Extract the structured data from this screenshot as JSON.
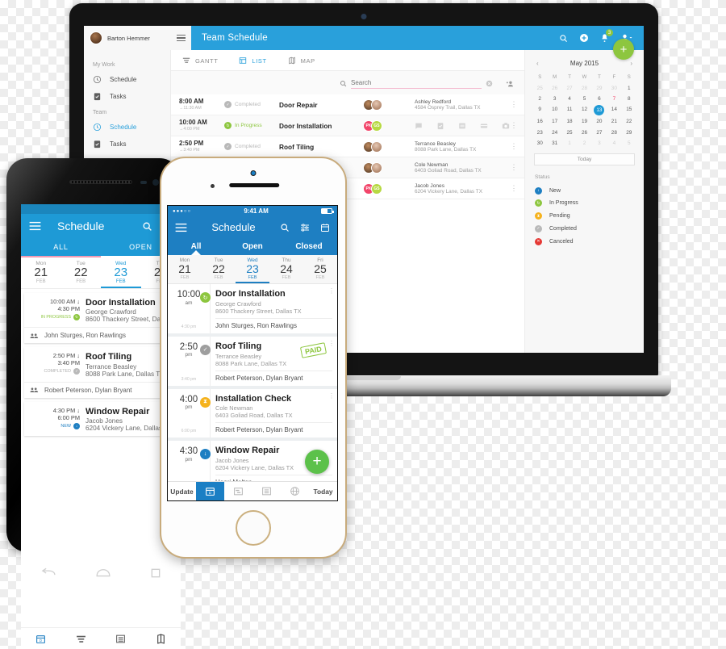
{
  "laptop": {
    "appbar": {
      "user_name": "Barton Hemmer",
      "title": "Team Schedule",
      "menu_icon": "hamburger-icon",
      "icons": [
        "search-icon",
        "add-circle-icon",
        "bell-icon",
        "account-icon"
      ],
      "notification_badge": "3"
    },
    "sidebar": {
      "sections": [
        {
          "label": "My Work",
          "items": [
            {
              "label": "Schedule",
              "icon": "clock-icon",
              "active": false
            },
            {
              "label": "Tasks",
              "icon": "clipboard-check-icon",
              "active": false
            }
          ]
        },
        {
          "label": "Team",
          "items": [
            {
              "label": "Schedule",
              "icon": "clock-icon",
              "active": true
            },
            {
              "label": "Tasks",
              "icon": "clipboard-check-icon",
              "active": false
            }
          ]
        }
      ]
    },
    "tabs": [
      {
        "label": "GANTT",
        "icon": "gantt-icon",
        "active": false
      },
      {
        "label": "LIST",
        "icon": "list-icon",
        "active": true
      },
      {
        "label": "MAP",
        "icon": "map-icon",
        "active": false
      }
    ],
    "search": {
      "placeholder": "Search",
      "value": "",
      "clear_icon": "clear-circle-icon",
      "add_user_icon": "add-person-icon"
    },
    "rows": [
      {
        "time": "8:00 AM",
        "end": "→11:30 AM",
        "status": "Completed",
        "status_color": "#b9b9b9",
        "title": "Door Repair",
        "avatars": [
          "photo1",
          "photo2"
        ],
        "person": "Ashley Redford",
        "address": "4584 Osprey Trail, Dallas TX",
        "mode": "person"
      },
      {
        "time": "10:00 AM",
        "end": "→4:00 PM",
        "status": "In Progress",
        "status_color": "#8dc63f",
        "title": "Door Installation",
        "avatars": [
          "PK",
          "GS"
        ],
        "person": "",
        "address": "",
        "mode": "icons",
        "action_icons": [
          "chat-icon",
          "checklist-icon",
          "document-icon",
          "card-icon",
          "camera-icon"
        ]
      },
      {
        "time": "2:50 PM",
        "end": "→3:40 PM",
        "status": "Completed",
        "status_color": "#b9b9b9",
        "title": "Roof Tiling",
        "avatars": [
          "photo1",
          "photo2"
        ],
        "person": "Terrance Beasley",
        "address": "8088 Park Lane, Dallas TX",
        "mode": "person"
      },
      {
        "time": "",
        "end": "",
        "status": "",
        "status_color": "",
        "title": "",
        "avatars": [
          "photo1",
          "photo2"
        ],
        "person": "Cole Newman",
        "address": "6403 Goliad Road, Dallas TX",
        "mode": "person"
      },
      {
        "time": "",
        "end": "",
        "status": "",
        "status_color": "",
        "title": "",
        "avatars": [
          "PK",
          "GS"
        ],
        "person": "Jacob Jones",
        "address": "6204 Vickery Lane, Dallas TX",
        "mode": "person"
      }
    ],
    "fab_label": "+",
    "calendar": {
      "month": "May 2015",
      "prev": "‹",
      "next": "›",
      "dow": [
        "S",
        "M",
        "T",
        "W",
        "T",
        "F",
        "S"
      ],
      "weeks": [
        [
          {
            "d": "25",
            "t": "mute"
          },
          {
            "d": "26",
            "t": "mute"
          },
          {
            "d": "27",
            "t": "mute"
          },
          {
            "d": "28",
            "t": "mute"
          },
          {
            "d": "29",
            "t": "mute"
          },
          {
            "d": "30",
            "t": "mute"
          },
          {
            "d": "1",
            "t": ""
          }
        ],
        [
          {
            "d": "2",
            "t": ""
          },
          {
            "d": "3",
            "t": ""
          },
          {
            "d": "4",
            "t": ""
          },
          {
            "d": "5",
            "t": ""
          },
          {
            "d": "6",
            "t": ""
          },
          {
            "d": "7",
            "t": "red"
          },
          {
            "d": "8",
            "t": ""
          }
        ],
        [
          {
            "d": "9",
            "t": ""
          },
          {
            "d": "10",
            "t": ""
          },
          {
            "d": "11",
            "t": ""
          },
          {
            "d": "12",
            "t": ""
          },
          {
            "d": "13",
            "t": "sel"
          },
          {
            "d": "14",
            "t": ""
          },
          {
            "d": "15",
            "t": ""
          }
        ],
        [
          {
            "d": "16",
            "t": ""
          },
          {
            "d": "17",
            "t": ""
          },
          {
            "d": "18",
            "t": ""
          },
          {
            "d": "19",
            "t": ""
          },
          {
            "d": "20",
            "t": ""
          },
          {
            "d": "21",
            "t": ""
          },
          {
            "d": "22",
            "t": ""
          }
        ],
        [
          {
            "d": "23",
            "t": ""
          },
          {
            "d": "24",
            "t": ""
          },
          {
            "d": "25",
            "t": ""
          },
          {
            "d": "26",
            "t": ""
          },
          {
            "d": "27",
            "t": ""
          },
          {
            "d": "28",
            "t": ""
          },
          {
            "d": "29",
            "t": ""
          }
        ],
        [
          {
            "d": "30",
            "t": ""
          },
          {
            "d": "31",
            "t": ""
          },
          {
            "d": "1",
            "t": "mute"
          },
          {
            "d": "2",
            "t": "mute"
          },
          {
            "d": "3",
            "t": "mute"
          },
          {
            "d": "4",
            "t": "mute"
          },
          {
            "d": "5",
            "t": "mute"
          }
        ]
      ],
      "today_label": "Today"
    },
    "status_legend": {
      "title": "Status",
      "items": [
        {
          "label": "New",
          "color": "#1e7fc2",
          "glyph": "↓"
        },
        {
          "label": "In Progress",
          "color": "#8dc63f",
          "glyph": "↻"
        },
        {
          "label": "Pending",
          "color": "#f5b21d",
          "glyph": "⧗"
        },
        {
          "label": "Completed",
          "color": "#b9b9b9",
          "glyph": "✓"
        },
        {
          "label": "Canceled",
          "color": "#e53935",
          "glyph": "✕"
        }
      ]
    }
  },
  "android": {
    "title": "Schedule",
    "menu_icon": "hamburger-icon",
    "header_icons": [
      "search-icon",
      "filter-icon"
    ],
    "tabs": [
      "ALL",
      "OPEN"
    ],
    "days": [
      {
        "dow": "Mon",
        "num": "21",
        "mon": "FEB",
        "on": false
      },
      {
        "dow": "Tue",
        "num": "22",
        "mon": "FEB",
        "on": false
      },
      {
        "dow": "Wed",
        "num": "23",
        "mon": "FEB",
        "on": true
      },
      {
        "dow": "Thu",
        "num": "24",
        "mon": "FEB",
        "on": false
      }
    ],
    "cards": [
      {
        "start": "10:00 AM ↓",
        "end": "4:30 PM",
        "status": "IN PROGRESS",
        "status_color": "#8dc63f",
        "title": "Door Installation",
        "person": "George Crawford",
        "address": "8600 Thackery Street, Dalla",
        "crew": "John Sturges, Ron Rawlings"
      },
      {
        "start": "2:50 PM ↓",
        "end": "3:40 PM",
        "status": "COMPLETED",
        "status_color": "#b9b9b9",
        "title": "Roof Tiling",
        "person": "Terrance Beasley",
        "address": "8088 Park Lane, Dallas TX",
        "crew": "Robert Peterson, Dylan Bryant"
      },
      {
        "start": "4:30 PM ↓",
        "end": "6:00 PM",
        "status": "NEW",
        "status_color": "#1e7fc2",
        "title": "Window Repair",
        "person": "Jacob Jones",
        "address": "6204 Vickery Lane, Dallas T",
        "crew": ""
      }
    ],
    "nav_icons": [
      "calendar-icon",
      "gantt-icon",
      "list-icon",
      "map-icon"
    ],
    "soft_keys": [
      "back-icon",
      "home-icon",
      "recents-icon"
    ]
  },
  "iphone": {
    "status": {
      "signal": "●●●○○",
      "time": "9:41 AM",
      "battery_icon": "battery-icon"
    },
    "title": "Schedule",
    "menu_icon": "hamburger-icon",
    "header_icons": [
      "search-icon",
      "filter-icon",
      "calendar-icon"
    ],
    "tabs": [
      "All",
      "Open",
      "Closed"
    ],
    "days": [
      {
        "dow": "Mon",
        "num": "21",
        "mon": "FEB",
        "on": false
      },
      {
        "dow": "Tue",
        "num": "22",
        "mon": "FEB",
        "on": false
      },
      {
        "dow": "Wed",
        "num": "23",
        "mon": "FEB",
        "on": true
      },
      {
        "dow": "Thu",
        "num": "24",
        "mon": "FEB",
        "on": false
      },
      {
        "dow": "Fri",
        "num": "25",
        "mon": "FEB",
        "on": false
      }
    ],
    "cards": [
      {
        "time": "10:00",
        "ampm": "am",
        "end": "4:30 pm",
        "status_color": "#8dc63f",
        "status_glyph": "↻",
        "title": "Door Installation",
        "person": "George Crawford",
        "address": "8600 Thackery Street, Dallas TX",
        "crew": "John Sturges, Ron Rawlings",
        "badge": ""
      },
      {
        "time": "2:50",
        "ampm": "pm",
        "end": "3:40 pm",
        "status_color": "#9e9e9e",
        "status_glyph": "✓",
        "title": "Roof Tiling",
        "person": "Terrance Beasley",
        "address": "8088 Park Lane, Dallas TX",
        "crew": "Robert Peterson, Dylan Bryant",
        "badge": "PAID"
      },
      {
        "time": "4:00",
        "ampm": "pm",
        "end": "6:00 pm",
        "status_color": "#f5b21d",
        "status_glyph": "⧗",
        "title": "Installation Check",
        "person": "Cole Newman",
        "address": "6403 Goliad Road, Dallas TX",
        "crew": "Robert Peterson, Dylan Bryant",
        "badge": ""
      },
      {
        "time": "4:30",
        "ampm": "pm",
        "end": "",
        "status_color": "#1e7fc2",
        "status_glyph": "↓",
        "title": "Window Repair",
        "person": "Jacob Jones",
        "address": "6204 Vickery Lane, Dallas TX",
        "crew": "Henri Melton",
        "badge": ""
      }
    ],
    "fab_label": "+",
    "toolbar": {
      "left": "Update",
      "right": "Today",
      "icons": [
        "calendar-icon",
        "gantt-icon",
        "list-icon",
        "globe-icon"
      ]
    }
  }
}
